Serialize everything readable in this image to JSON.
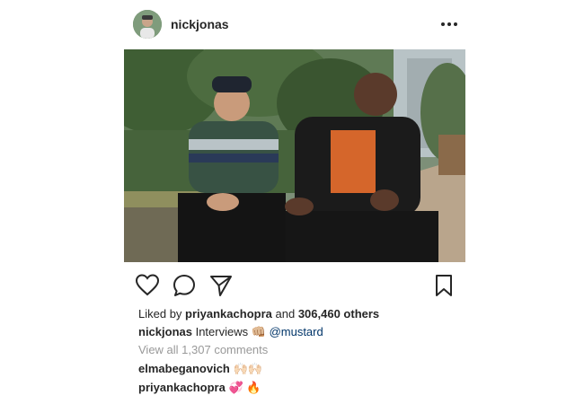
{
  "post": {
    "author": "nickjonas",
    "more_icon": "more-horizontal-icon",
    "actions": {
      "like_icon": "heart-icon",
      "comment_icon": "comment-icon",
      "share_icon": "send-icon",
      "save_icon": "bookmark-icon"
    },
    "likes": {
      "prefix": "Liked by",
      "user": "priyankachopra",
      "joiner": "and",
      "count_text": "306,460 others"
    },
    "caption": {
      "user": "nickjonas",
      "text": "Interviews",
      "emoji": "👊🏼",
      "mention": "@mustard"
    },
    "view_comments": "View all 1,307 comments",
    "comments": [
      {
        "user": "elmabeganovich",
        "text": "🙌🏻🙌🏻"
      },
      {
        "user": "priyankachopra",
        "text": "💞 🔥"
      }
    ]
  },
  "colors": {
    "text": "#262626",
    "muted": "#999999",
    "mention": "#003569"
  }
}
